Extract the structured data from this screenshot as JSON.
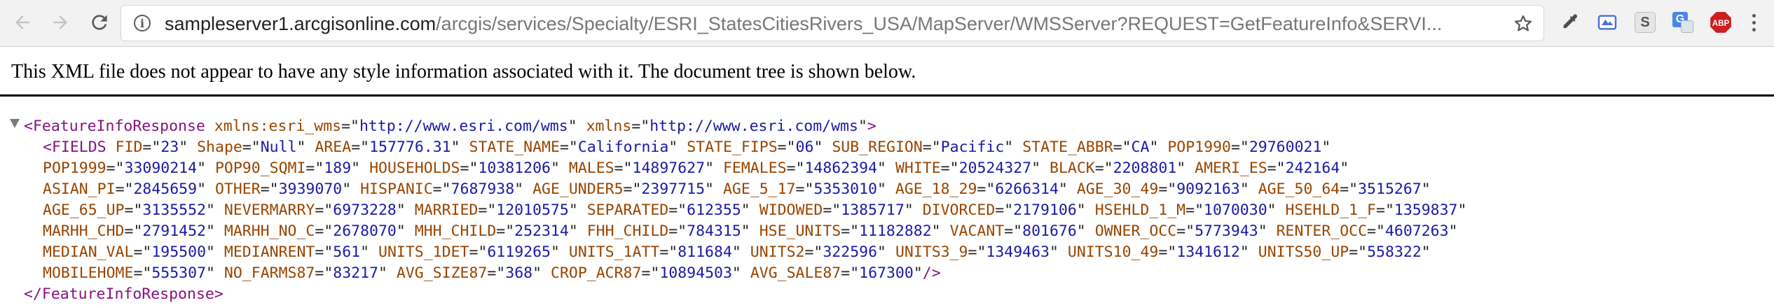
{
  "browser": {
    "url_host": "sampleserver1.arcgisonline.com",
    "url_path": "/arcgis/services/Specialty/ESRI_StatesCitiesRivers_USA/MapServer/WMSServer?REQUEST=GetFeatureInfo&SERVI...",
    "icons": [
      "back-arrow-icon",
      "forward-arrow-icon",
      "reload-icon",
      "site-info-icon",
      "bookmark-star-icon",
      "eyedropper-icon",
      "drive-icon",
      "s-extension-icon",
      "translate-icon",
      "adblock-icon",
      "menu-icon"
    ],
    "extension_labels": {
      "s": "S",
      "translate": "G",
      "adblock": "ABP"
    },
    "colors": {
      "adblock": "#cc1f1f",
      "translate": "#4a86e8",
      "drive": "#4a6fd3"
    }
  },
  "page": {
    "notice": "This XML file does not appear to have any style information associated with it. The document tree is shown below."
  },
  "xml": {
    "root_tag": "FeatureInfoResponse",
    "namespaces": [
      {
        "name": "xmlns:esri_wms",
        "value": "http://www.esri.com/wms"
      },
      {
        "name": "xmlns",
        "value": "http://www.esri.com/wms"
      }
    ],
    "fields_tag": "FIELDS",
    "closing": "</FeatureInfoResponse>",
    "attribute_lines": [
      [
        {
          "n": "FID",
          "v": "23"
        },
        {
          "n": "Shape",
          "v": "Null"
        },
        {
          "n": "AREA",
          "v": "157776.31"
        },
        {
          "n": "STATE_NAME",
          "v": "California"
        },
        {
          "n": "STATE_FIPS",
          "v": "06"
        },
        {
          "n": "SUB_REGION",
          "v": "Pacific"
        },
        {
          "n": "STATE_ABBR",
          "v": "CA"
        },
        {
          "n": "POP1990",
          "v": "29760021"
        }
      ],
      [
        {
          "n": "POP1999",
          "v": "33090214"
        },
        {
          "n": "POP90_SQMI",
          "v": "189"
        },
        {
          "n": "HOUSEHOLDS",
          "v": "10381206"
        },
        {
          "n": "MALES",
          "v": "14897627"
        },
        {
          "n": "FEMALES",
          "v": "14862394"
        },
        {
          "n": "WHITE",
          "v": "20524327"
        },
        {
          "n": "BLACK",
          "v": "2208801"
        },
        {
          "n": "AMERI_ES",
          "v": "242164"
        }
      ],
      [
        {
          "n": "ASIAN_PI",
          "v": "2845659"
        },
        {
          "n": "OTHER",
          "v": "3939070"
        },
        {
          "n": "HISPANIC",
          "v": "7687938"
        },
        {
          "n": "AGE_UNDER5",
          "v": "2397715"
        },
        {
          "n": "AGE_5_17",
          "v": "5353010"
        },
        {
          "n": "AGE_18_29",
          "v": "6266314"
        },
        {
          "n": "AGE_30_49",
          "v": "9092163"
        },
        {
          "n": "AGE_50_64",
          "v": "3515267"
        }
      ],
      [
        {
          "n": "AGE_65_UP",
          "v": "3135552"
        },
        {
          "n": "NEVERMARRY",
          "v": "6973228"
        },
        {
          "n": "MARRIED",
          "v": "12010575"
        },
        {
          "n": "SEPARATED",
          "v": "612355"
        },
        {
          "n": "WIDOWED",
          "v": "1385717"
        },
        {
          "n": "DIVORCED",
          "v": "2179106"
        },
        {
          "n": "HSEHLD_1_M",
          "v": "1070030"
        },
        {
          "n": "HSEHLD_1_F",
          "v": "1359837"
        }
      ],
      [
        {
          "n": "MARHH_CHD",
          "v": "2791452"
        },
        {
          "n": "MARHH_NO_C",
          "v": "2678070"
        },
        {
          "n": "MHH_CHILD",
          "v": "252314"
        },
        {
          "n": "FHH_CHILD",
          "v": "784315"
        },
        {
          "n": "HSE_UNITS",
          "v": "11182882"
        },
        {
          "n": "VACANT",
          "v": "801676"
        },
        {
          "n": "OWNER_OCC",
          "v": "5773943"
        },
        {
          "n": "RENTER_OCC",
          "v": "4607263"
        }
      ],
      [
        {
          "n": "MEDIAN_VAL",
          "v": "195500"
        },
        {
          "n": "MEDIANRENT",
          "v": "561"
        },
        {
          "n": "UNITS_1DET",
          "v": "6119265"
        },
        {
          "n": "UNITS_1ATT",
          "v": "811684"
        },
        {
          "n": "UNITS2",
          "v": "322596"
        },
        {
          "n": "UNITS3_9",
          "v": "1349463"
        },
        {
          "n": "UNITS10_49",
          "v": "1341612"
        },
        {
          "n": "UNITS50_UP",
          "v": "558322"
        }
      ],
      [
        {
          "n": "MOBILEHOME",
          "v": "555307"
        },
        {
          "n": "NO_FARMS87",
          "v": "83217"
        },
        {
          "n": "AVG_SIZE87",
          "v": "368"
        },
        {
          "n": "CROP_ACR87",
          "v": "10894503"
        },
        {
          "n": "AVG_SALE87",
          "v": "167300"
        }
      ]
    ]
  }
}
